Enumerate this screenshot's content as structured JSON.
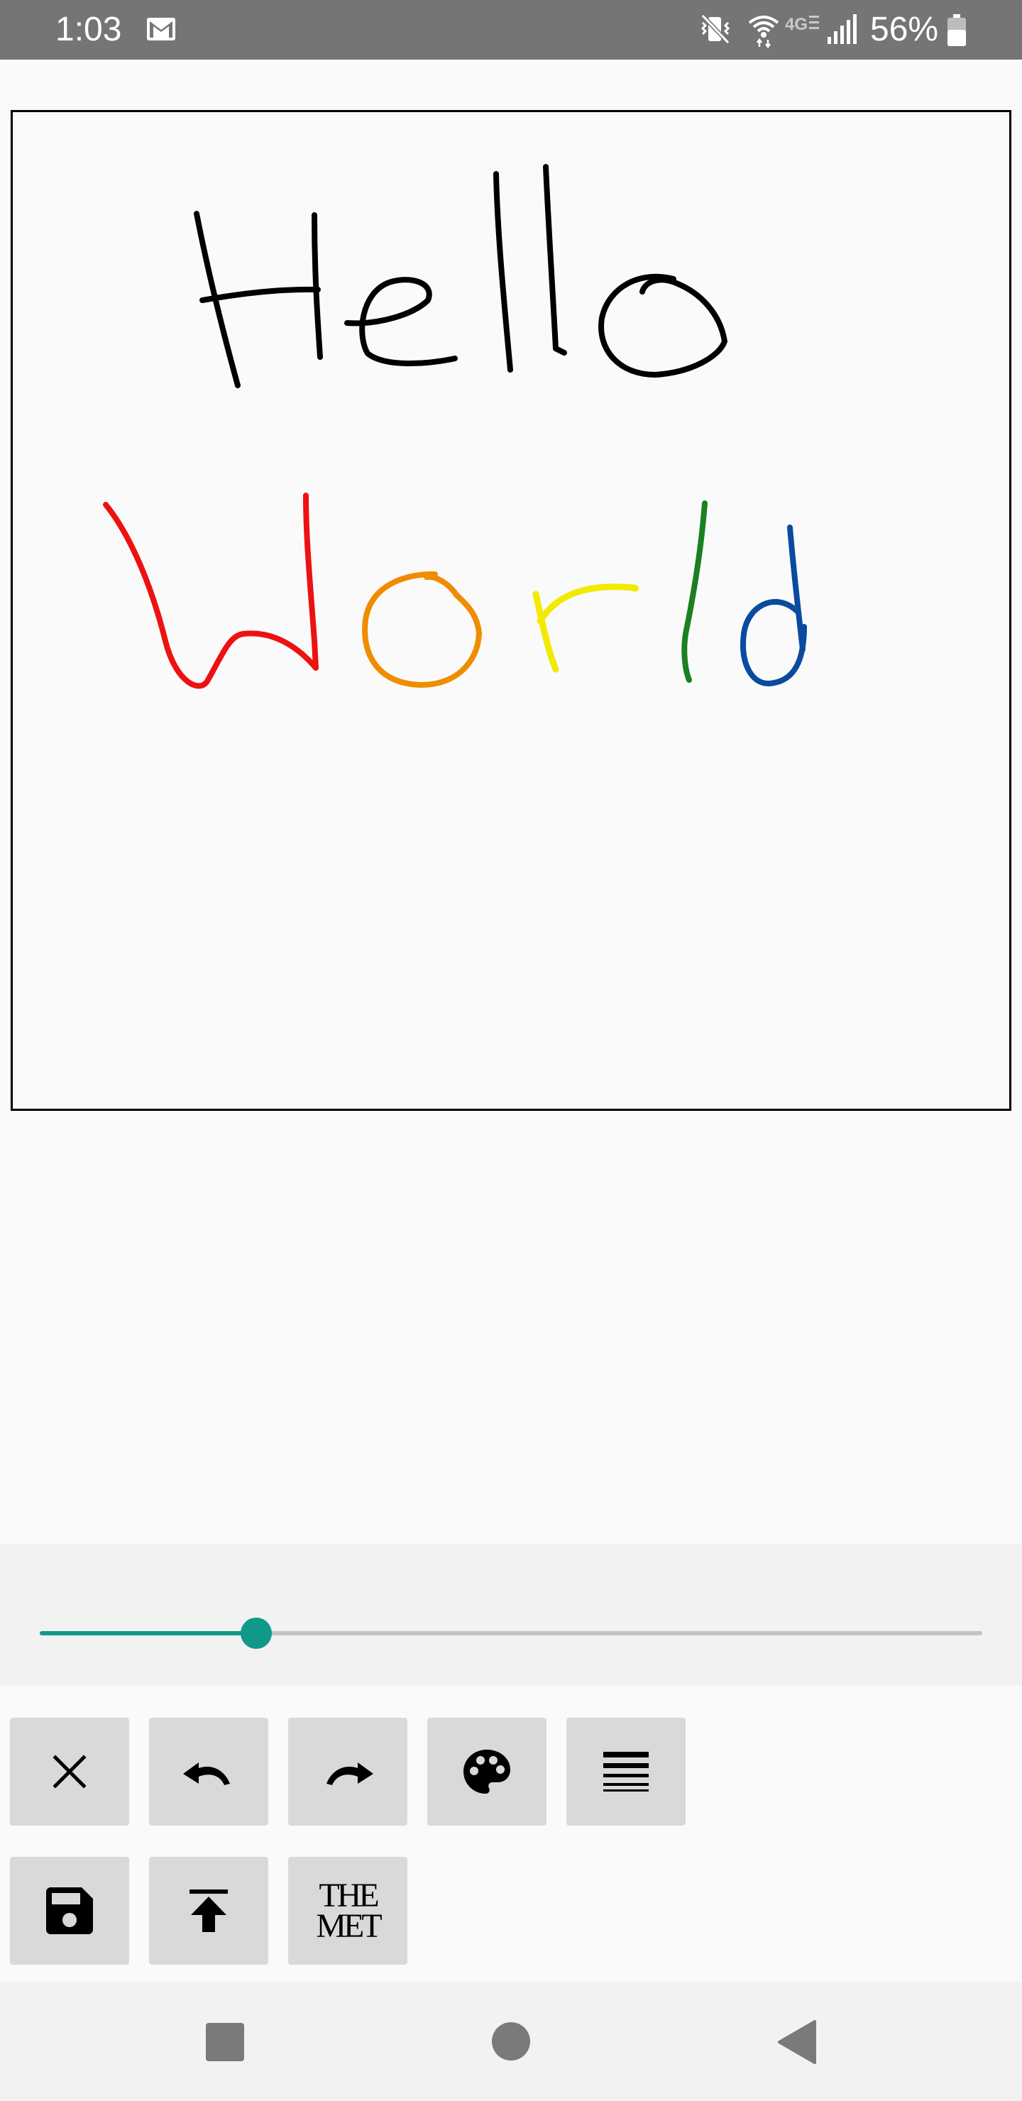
{
  "status_bar": {
    "time": "1:03",
    "battery_percent": "56%",
    "icons": [
      "gmail-icon",
      "vibrate-icon",
      "wifi-icon",
      "lte-icon",
      "signal-icon",
      "battery-icon"
    ]
  },
  "canvas": {
    "stroke_colors": {
      "hello": "#000000",
      "w": "#ee1111",
      "o": "#f08c00",
      "r": "#f2ea00",
      "l": "#1a8020",
      "d": "#0a4aa0"
    }
  },
  "brush_slider": {
    "value": 0.23,
    "accent": "#109988"
  },
  "toolbar": {
    "row1": [
      "clear-icon",
      "undo-icon",
      "redo-icon",
      "palette-icon",
      "stroke-width-icon"
    ],
    "row2": [
      "save-icon",
      "upload-icon",
      "met-logo"
    ],
    "met_logo_line1": "THE",
    "met_logo_line2": "MET"
  },
  "nav_bar": {
    "icons": [
      "recents-icon",
      "home-icon",
      "back-icon"
    ]
  }
}
